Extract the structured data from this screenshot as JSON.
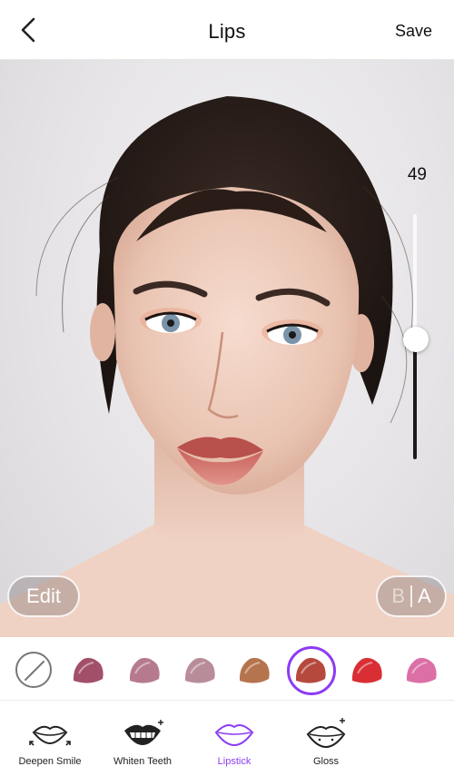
{
  "header": {
    "title": "Lips",
    "save_label": "Save"
  },
  "intensity": {
    "value": "49",
    "fraction": 0.49
  },
  "overlay": {
    "edit_label": "Edit",
    "before_label": "B",
    "after_label": "A"
  },
  "swatches": [
    {
      "name": "none",
      "color": ""
    },
    {
      "name": "mauve",
      "color": "#a2506a"
    },
    {
      "name": "dusty-rose",
      "color": "#b57a8e"
    },
    {
      "name": "pale-mauve",
      "color": "#b88d99"
    },
    {
      "name": "caramel",
      "color": "#b5744d"
    },
    {
      "name": "terracotta",
      "color": "#b6493e"
    },
    {
      "name": "red",
      "color": "#d92e34"
    },
    {
      "name": "pink",
      "color": "#db6fa6"
    }
  ],
  "selected_swatch": "terracotta",
  "tools": [
    {
      "label": "Deepen Smile",
      "icon": "deepen-smile-icon"
    },
    {
      "label": "Whiten Teeth",
      "icon": "whiten-teeth-icon"
    },
    {
      "label": "Lipstick",
      "icon": "lipstick-icon"
    },
    {
      "label": "Gloss",
      "icon": "gloss-icon"
    }
  ],
  "active_tool": "Lipstick",
  "colors": {
    "accent": "#8c3cf3"
  }
}
